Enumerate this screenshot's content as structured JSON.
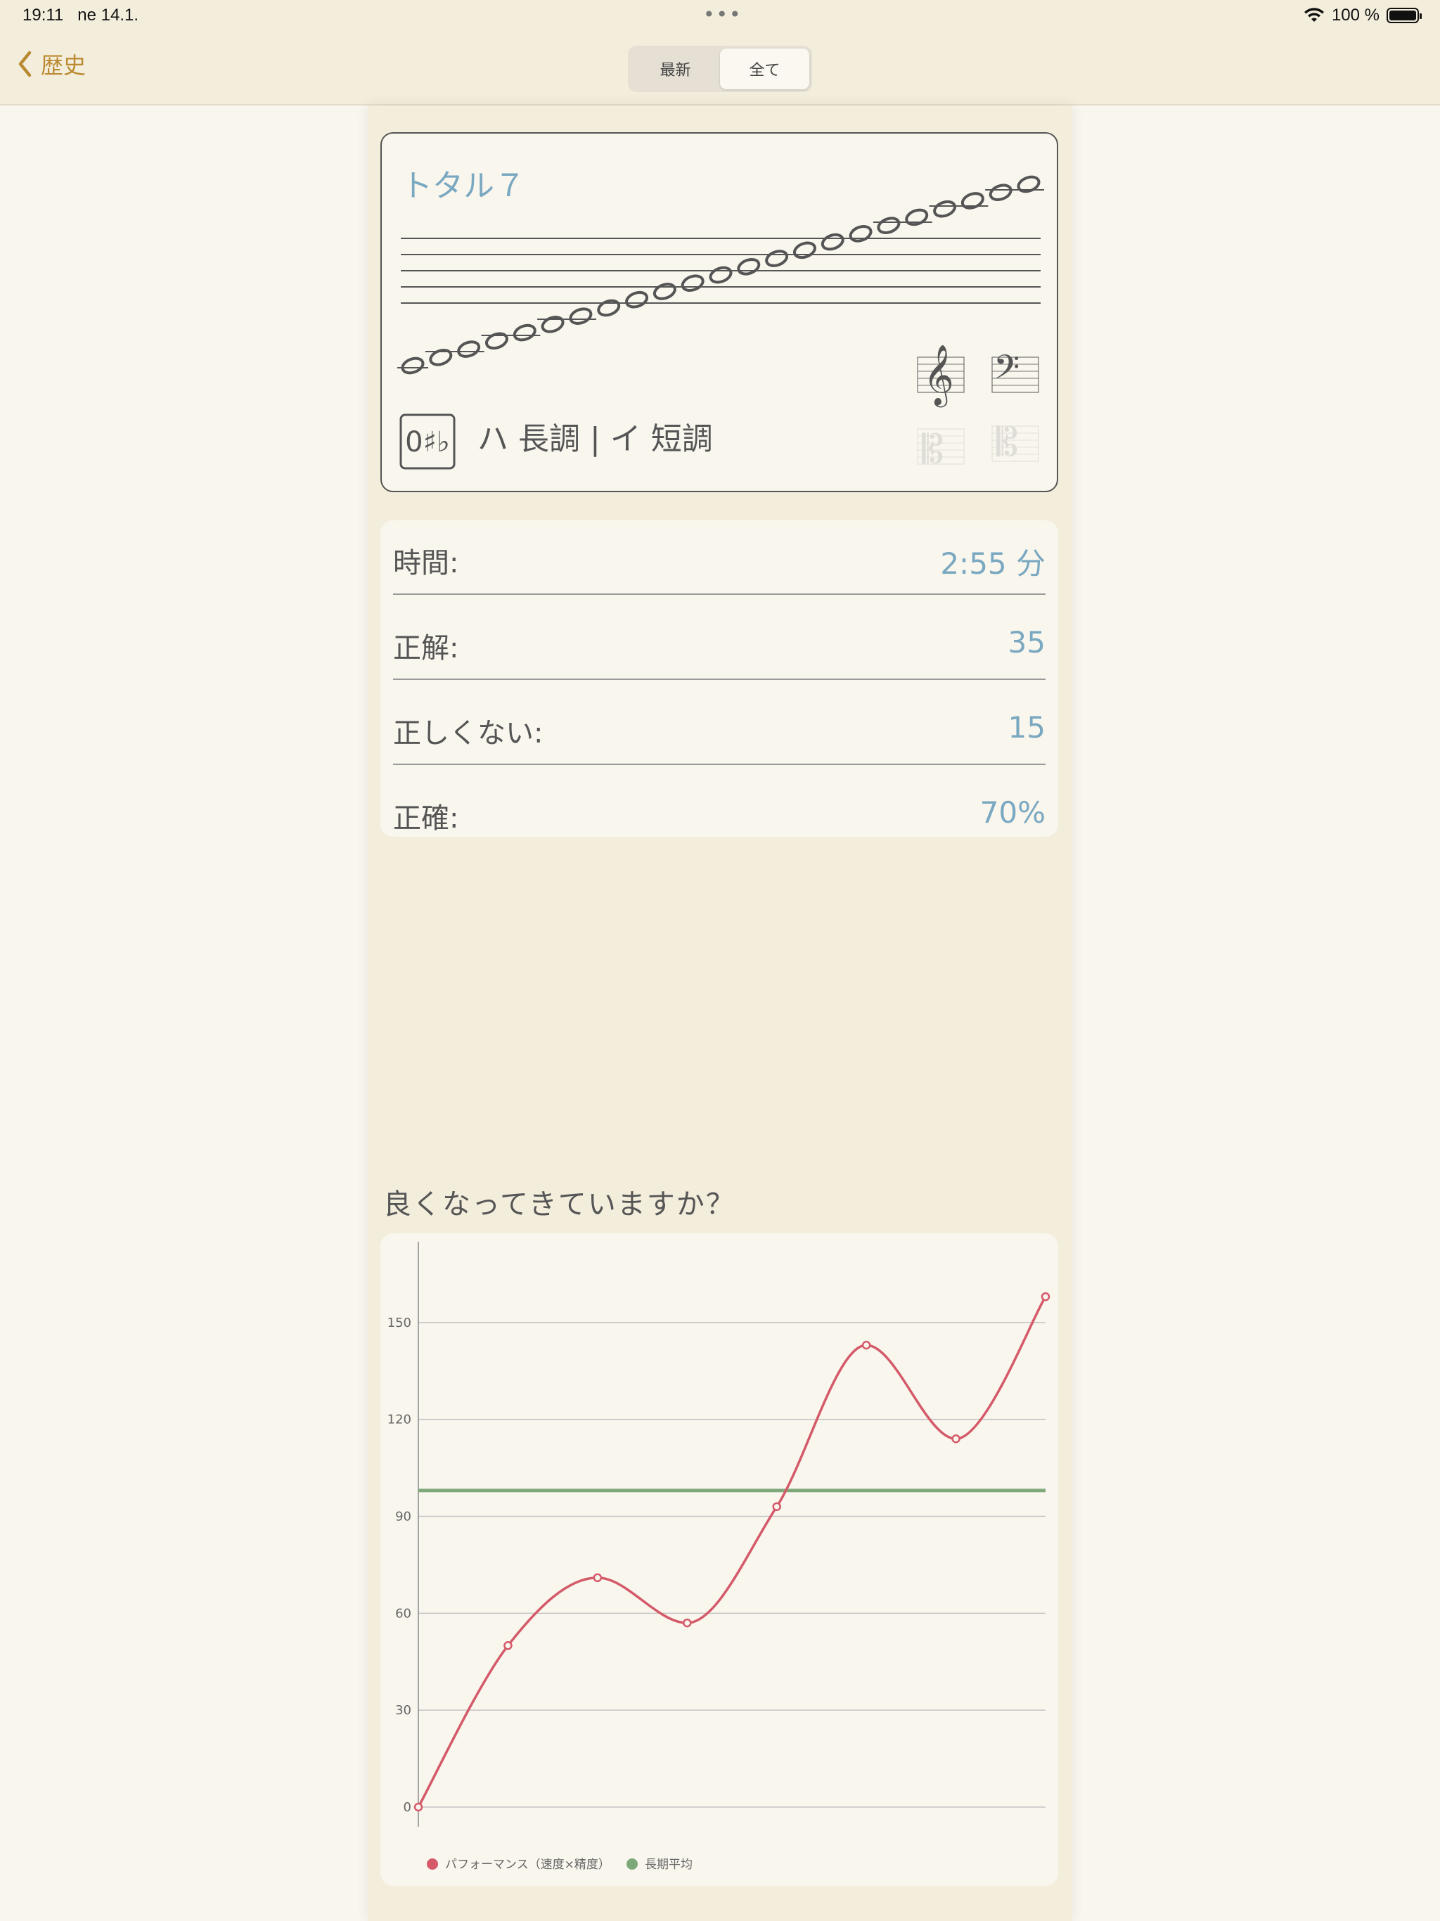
{
  "status_bar": {
    "time": "19:11",
    "date": "ne 14.1.",
    "dots": "•••",
    "battery": "100 %"
  },
  "nav": {
    "back_label": "歴史",
    "segments": [
      "最新",
      "全て"
    ],
    "selected_segment": "全て"
  },
  "exercise": {
    "title": "トタル７",
    "key_badge": "0♯♭",
    "key_label": "ハ 長調 | イ 短調",
    "clefs": [
      {
        "name": "treble-clef",
        "enabled": true
      },
      {
        "name": "bass-clef",
        "enabled": true
      },
      {
        "name": "alto-clef",
        "enabled": false
      },
      {
        "name": "tenor-clef",
        "enabled": false
      }
    ],
    "accent_color": "#7aa8c1"
  },
  "stats": [
    {
      "label": "時間:",
      "value": "2:55 分"
    },
    {
      "label": "正解:",
      "value": "35"
    },
    {
      "label": "正しくない:",
      "value": "15"
    },
    {
      "label": "正確:",
      "value": "70%"
    }
  ],
  "section_heading": "良くなってきていますか？",
  "chart_data": {
    "type": "line",
    "x": [
      0,
      1,
      2,
      3,
      4,
      5,
      6,
      7
    ],
    "series": [
      {
        "name": "パフォーマンス（速度×精度）",
        "values": [
          0,
          50,
          71,
          57,
          93,
          143,
          114,
          158
        ],
        "color": "#d45a6a"
      },
      {
        "name": "長期平均",
        "values": [
          98,
          98,
          98,
          98,
          98,
          98,
          98,
          98
        ],
        "color": "#7fa87a"
      }
    ],
    "y_ticks": [
      "0",
      "30",
      "60",
      "90",
      "120",
      "150"
    ],
    "ylim": [
      0,
      175
    ],
    "grid": true,
    "legend_position": "bottom-left"
  }
}
